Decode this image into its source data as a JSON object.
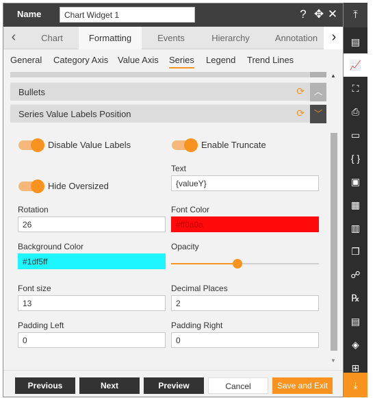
{
  "header": {
    "name_label": "Name",
    "name_value": "Chart Widget 1",
    "help_icon": "?",
    "move_icon": "✥",
    "close_icon": "✕"
  },
  "tabs": {
    "prev_arrow": "‹",
    "next_arrow": "›",
    "items": [
      "Chart",
      "Formatting",
      "Events",
      "Hierarchy",
      "Annotation"
    ],
    "active": "Formatting"
  },
  "subtabs": {
    "items": [
      "General",
      "Category Axis",
      "Value Axis",
      "Series",
      "Legend",
      "Trend Lines"
    ],
    "active": "Series"
  },
  "sections": {
    "bullets": {
      "label": "Bullets",
      "toggle_glyph": "︿",
      "refresh_glyph": "⟳"
    },
    "labels_position": {
      "label": "Series Value Labels Position",
      "toggle_glyph": "﹀",
      "refresh_glyph": "⟳"
    }
  },
  "form": {
    "disable_value_labels": {
      "label": "Disable Value Labels",
      "on": true
    },
    "enable_truncate": {
      "label": "Enable Truncate",
      "on": true
    },
    "hide_oversized": {
      "label": "Hide Oversized",
      "on": true
    },
    "text": {
      "label": "Text",
      "value": "{valueY}"
    },
    "rotation": {
      "label": "Rotation",
      "value": "26"
    },
    "font_color": {
      "label": "Font Color",
      "value": "#ff0a0a",
      "swatch": "#ff0a0a"
    },
    "background_color": {
      "label": "Background Color",
      "value": "#1df5ff",
      "swatch": "#1df5ff"
    },
    "opacity": {
      "label": "Opacity",
      "level": 0.45
    },
    "font_size": {
      "label": "Font size",
      "value": "13"
    },
    "decimal_places": {
      "label": "Decimal Places",
      "value": "2"
    },
    "padding_left": {
      "label": "Padding Left",
      "value": "0"
    },
    "padding_right": {
      "label": "Padding Right",
      "value": "0"
    }
  },
  "footer": {
    "previous": "Previous",
    "next": "Next",
    "preview": "Preview",
    "cancel": "Cancel",
    "save_exit": "Save and Exit"
  },
  "sidebar": {
    "top_icon": "⤒",
    "items": [
      "table-icon",
      "line-chart-icon",
      "map-icon",
      "document-icon",
      "file-icon",
      "code-braces-icon",
      "image-icon",
      "kpi-icon",
      "bar-chart-icon",
      "copy-icon",
      "cluster-icon",
      "rx-icon",
      "report-icon",
      "layers-icon",
      "grid-icon"
    ],
    "glyphs": [
      "▤",
      "📈",
      "⛶",
      "⎙",
      "▭",
      "{ }",
      "▣",
      "▦",
      "▥",
      "❐",
      "☍",
      "℞",
      "▤",
      "◈",
      "⊞"
    ],
    "active": "line-chart-icon",
    "bottom_icon": "⤓"
  },
  "colors": {
    "accent": "#f7931e",
    "header": "#3f3f3f",
    "sidebar": "#2d2d2d"
  }
}
